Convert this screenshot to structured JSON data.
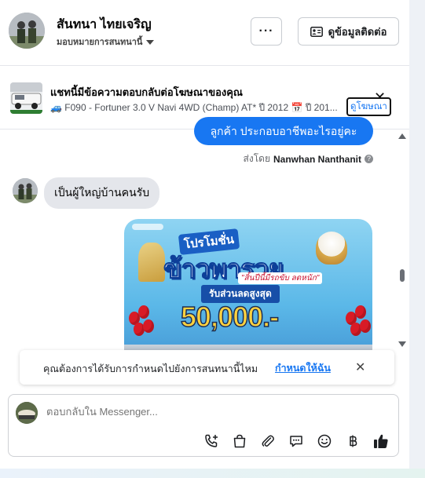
{
  "header": {
    "contact_name": "สันทนา ไทยเจริญ",
    "assign_label": "มอบหมายการสนทนานี้",
    "more_label": "···",
    "contact_info_label": "ดูข้อมูลติดต่อ"
  },
  "ad_context": {
    "title": "แชทนี้มีข้อความตอบกลับต่อโฆษณาของคุณ",
    "detail": "🚙 F090 - Fortuner 3.0 V Navi 4WD (Champ) AT* ปี 2012 📅 ปี 201...",
    "view_ad_label": "ดูโฆษณา",
    "close_label": "✕"
  },
  "messages": {
    "outgoing_text": "ลูกค้า ประกอบอาชีพอะไรอยู่คะ",
    "sent_by_prefix": "ส่งโดย",
    "sent_by_name": "Nanwhan Nanthanit",
    "incoming_text": "เป็นผู้ใหญ่บ้านคนรับ"
  },
  "promo_image": {
    "headline_top": "โปรโมชั่น",
    "headline_main": "ข้าวพารวย",
    "subline": "\"สิ้นปีนี้มีรถขับ ลดหนัก\"",
    "band": "รับส่วนลดสูงสุด",
    "amount": "50,000.-"
  },
  "reminder": {
    "text": "คุณต้องการได้รับการกำหนดไปยังการสนทนานี้ไหม",
    "link": "กำหนดให้ฉัน",
    "close": "✕"
  },
  "composer": {
    "placeholder": "ตอบกลับใน Messenger...",
    "tools": [
      "phone-plus-icon",
      "shopping-bag-icon",
      "paperclip-icon",
      "chat-bubble-icon",
      "smiley-icon",
      "baht-icon",
      "thumbs-up-icon"
    ]
  },
  "colors": {
    "accent": "#1877f2",
    "bubble_in": "#e4e6eb"
  }
}
